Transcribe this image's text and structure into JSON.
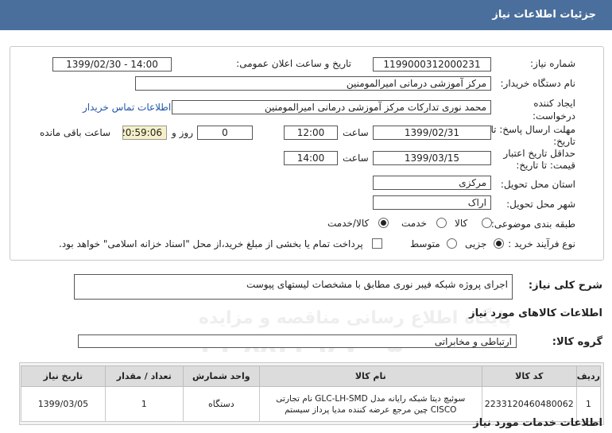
{
  "header": {
    "title": "جزئیات اطلاعات نیاز"
  },
  "form": {
    "need_number_label": "شماره نیاز:",
    "need_number": "1199000312000231",
    "announce_label": "تاریخ و ساعت اعلان عمومی:",
    "announce_value": "1399/02/30 - 14:00",
    "buyer_label": "نام دستگاه خریدار:",
    "buyer_value": "مرکز آموزشی درمانی امیرالمومنین",
    "creator_label": "ایجاد کننده درخواست:",
    "creator_value": "محمد نوری تدارکات مرکز آموزشی درمانی امیرالمومنین",
    "contact_link": "اطلاعات تماس خریدار",
    "deadline_label": "مهلت ارسال پاسخ: تا تاریخ:",
    "deadline_date": "1399/02/31",
    "time_label": "ساعت",
    "deadline_time": "12:00",
    "day_suffix": "روز و",
    "days_value": "0",
    "remaining_time": "20:59:06",
    "remaining_label": "ساعت باقی مانده",
    "validity_label": "حداقل تاریخ اعتبار قیمت: تا تاریخ:",
    "validity_date": "1399/03/15",
    "validity_time": "14:00",
    "province_label": "استان محل تحویل:",
    "province_value": "مرکزی",
    "city_label": "شهر محل تحویل:",
    "city_value": "اراک",
    "category_label": "طبقه بندی موضوعی:",
    "category_options": [
      "کالا",
      "خدمت",
      "کالا/خدمت"
    ],
    "category_selected": "کالا/خدمت",
    "purchase_label": "نوع فرآیند خرید :",
    "purchase_options": [
      "جزیی",
      "متوسط"
    ],
    "purchase_selected": "جزیی",
    "payment_note": "پرداخت تمام یا بخشی از مبلغ خرید،از محل \"اسناد خزانه اسلامی\" خواهد بود."
  },
  "description": {
    "label": "شرح کلی نیاز:",
    "value": "اجرای پروژه شبکه فیبر نوری مطابق با مشخصات لیستهای پیوست"
  },
  "goods_section": {
    "title": "اطلاعات کالاهای مورد نیاز"
  },
  "group": {
    "label": "گروه کالا:",
    "value": "ارتباطی و مخابراتی"
  },
  "table": {
    "headers": [
      "ردیف",
      "کد کالا",
      "نام کالا",
      "واحد شمارش",
      "تعداد / مقدار",
      "تاریخ نیاز"
    ],
    "rows": [
      [
        "1",
        "2233120460480062",
        "سوئیچ دیتا شبکه رایانه مدل GLC-LH-SMD نام تجارتی CISCO چین مرجع عرضه کننده مدیا پرداز سیستم",
        "دستگاه",
        "1",
        "1399/03/05"
      ]
    ]
  },
  "services_section": {
    "title": "اطلاعات خدمات مورد نیاز"
  },
  "watermark": {
    "line1": "پایگاه اطلاع رسانی مناقصه و مزایده",
    "line2": "۰۲۱-۸۸۳۴۹۶۷۰-۵"
  }
}
